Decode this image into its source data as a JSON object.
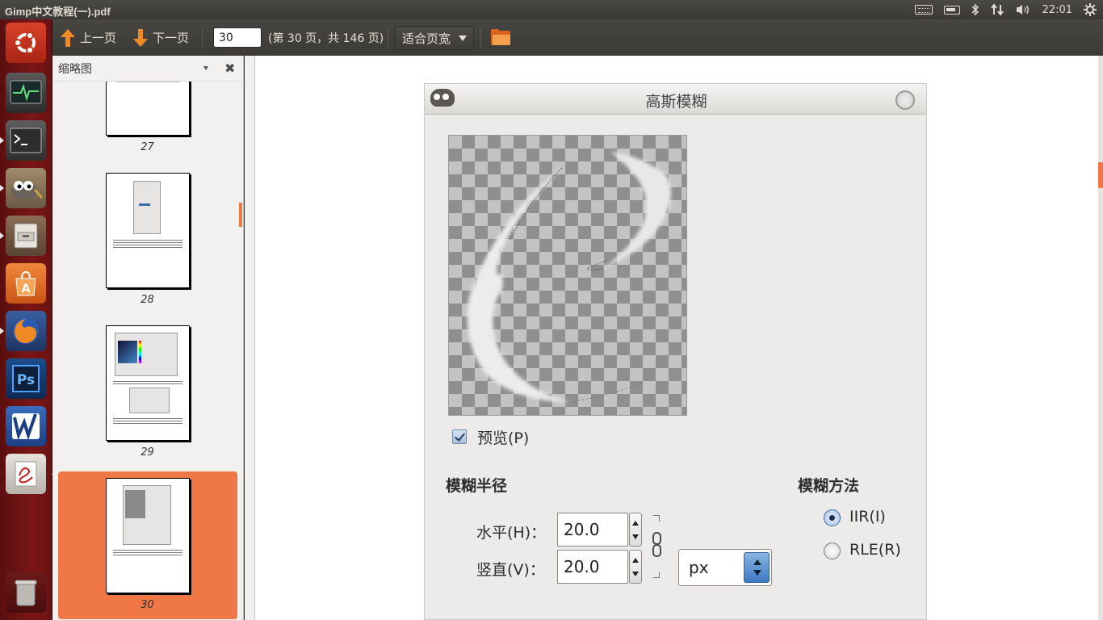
{
  "window": {
    "title": "Gimp中文教程(一).pdf"
  },
  "top_panel": {
    "clock": "22:01"
  },
  "launcher": {
    "items": [
      {
        "name": "ubuntu-dash",
        "icon": "ubuntu-logo-icon"
      },
      {
        "name": "system-monitor",
        "icon": "system-monitor-icon"
      },
      {
        "name": "terminal",
        "icon": "terminal-icon"
      },
      {
        "name": "gimp",
        "icon": "gimp-icon"
      },
      {
        "name": "file-manager",
        "icon": "file-cabinet-icon"
      },
      {
        "name": "software-center",
        "icon": "software-center-icon"
      },
      {
        "name": "firefox",
        "icon": "firefox-icon"
      },
      {
        "name": "photoshop",
        "icon": "photoshop-icon"
      },
      {
        "name": "wps-writer",
        "icon": "wps-writer-icon"
      },
      {
        "name": "pdf-reader",
        "icon": "pdf-reader-icon"
      },
      {
        "name": "trash",
        "icon": "trash-icon"
      }
    ]
  },
  "toolbar": {
    "prev_label": "上一页",
    "next_label": "下一页",
    "page_value": "30",
    "page_info": "(第 30 页，共 146 页)",
    "zoom_label": "适合页宽"
  },
  "sidebar": {
    "title": "缩略图",
    "thumbnails": [
      {
        "page": "27"
      },
      {
        "page": "28"
      },
      {
        "page": "29"
      },
      {
        "page": "30",
        "selected": true
      }
    ]
  },
  "dialog": {
    "title": "高斯模糊",
    "preview_label": "预览(P)",
    "preview_checked": true,
    "radius_heading": "模糊半径",
    "horizontal_label": "水平(H)：",
    "horizontal_value": "20.0",
    "vertical_label": "竖直(V)：",
    "vertical_value": "20.0",
    "unit": "px",
    "method_heading": "模糊方法",
    "methods": [
      {
        "label": "IIR(I)",
        "selected": true
      },
      {
        "label": "RLE(R)",
        "selected": false
      }
    ]
  },
  "colors": {
    "accent": "#f07746",
    "launcher_bg": "#6a1212",
    "toolbar_bg": "#3c3b37"
  }
}
